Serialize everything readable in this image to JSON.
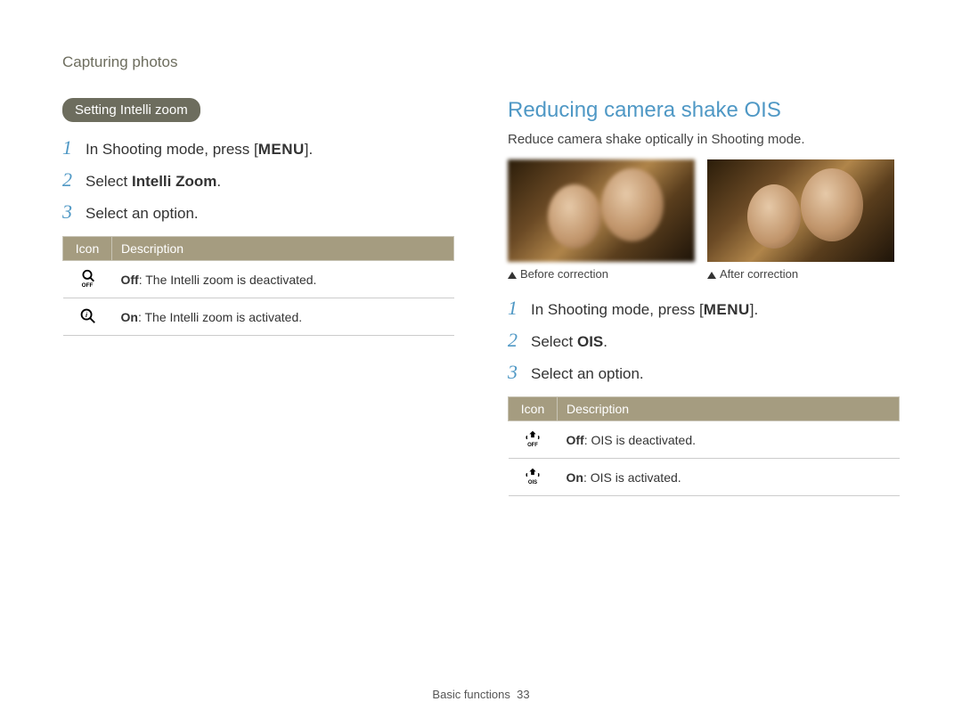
{
  "breadcrumb": "Capturing photos",
  "left": {
    "pill": "Setting Intelli zoom",
    "steps": [
      {
        "num": "1",
        "pre": "In Shooting mode, press [",
        "menu": "MENU",
        "post": "]."
      },
      {
        "num": "2",
        "pre": "Select ",
        "bold": "Intelli Zoom",
        "post": "."
      },
      {
        "num": "3",
        "text": "Select an option."
      }
    ],
    "table": {
      "head_icon": "Icon",
      "head_desc": "Description",
      "rows": [
        {
          "icon": "intelli-off-icon",
          "label": "Off",
          "desc": ": The Intelli zoom is deactivated."
        },
        {
          "icon": "intelli-on-icon",
          "label": "On",
          "desc": ": The Intelli zoom is activated."
        }
      ]
    }
  },
  "right": {
    "title": "Reducing camera shake OIS",
    "subtext": "Reduce camera shake optically in Shooting mode.",
    "caption_before": "Before correction",
    "caption_after": "After correction",
    "steps": [
      {
        "num": "1",
        "pre": "In Shooting mode, press [",
        "menu": "MENU",
        "post": "]."
      },
      {
        "num": "2",
        "pre": "Select ",
        "bold": "OIS",
        "post": "."
      },
      {
        "num": "3",
        "text": "Select an option."
      }
    ],
    "table": {
      "head_icon": "Icon",
      "head_desc": "Description",
      "rows": [
        {
          "icon": "ois-off-icon",
          "label": "Off",
          "desc": ": OIS is deactivated."
        },
        {
          "icon": "ois-on-icon",
          "label": "On",
          "desc": ": OIS is activated."
        }
      ]
    }
  },
  "footer": {
    "section": "Basic functions",
    "page": "33"
  }
}
